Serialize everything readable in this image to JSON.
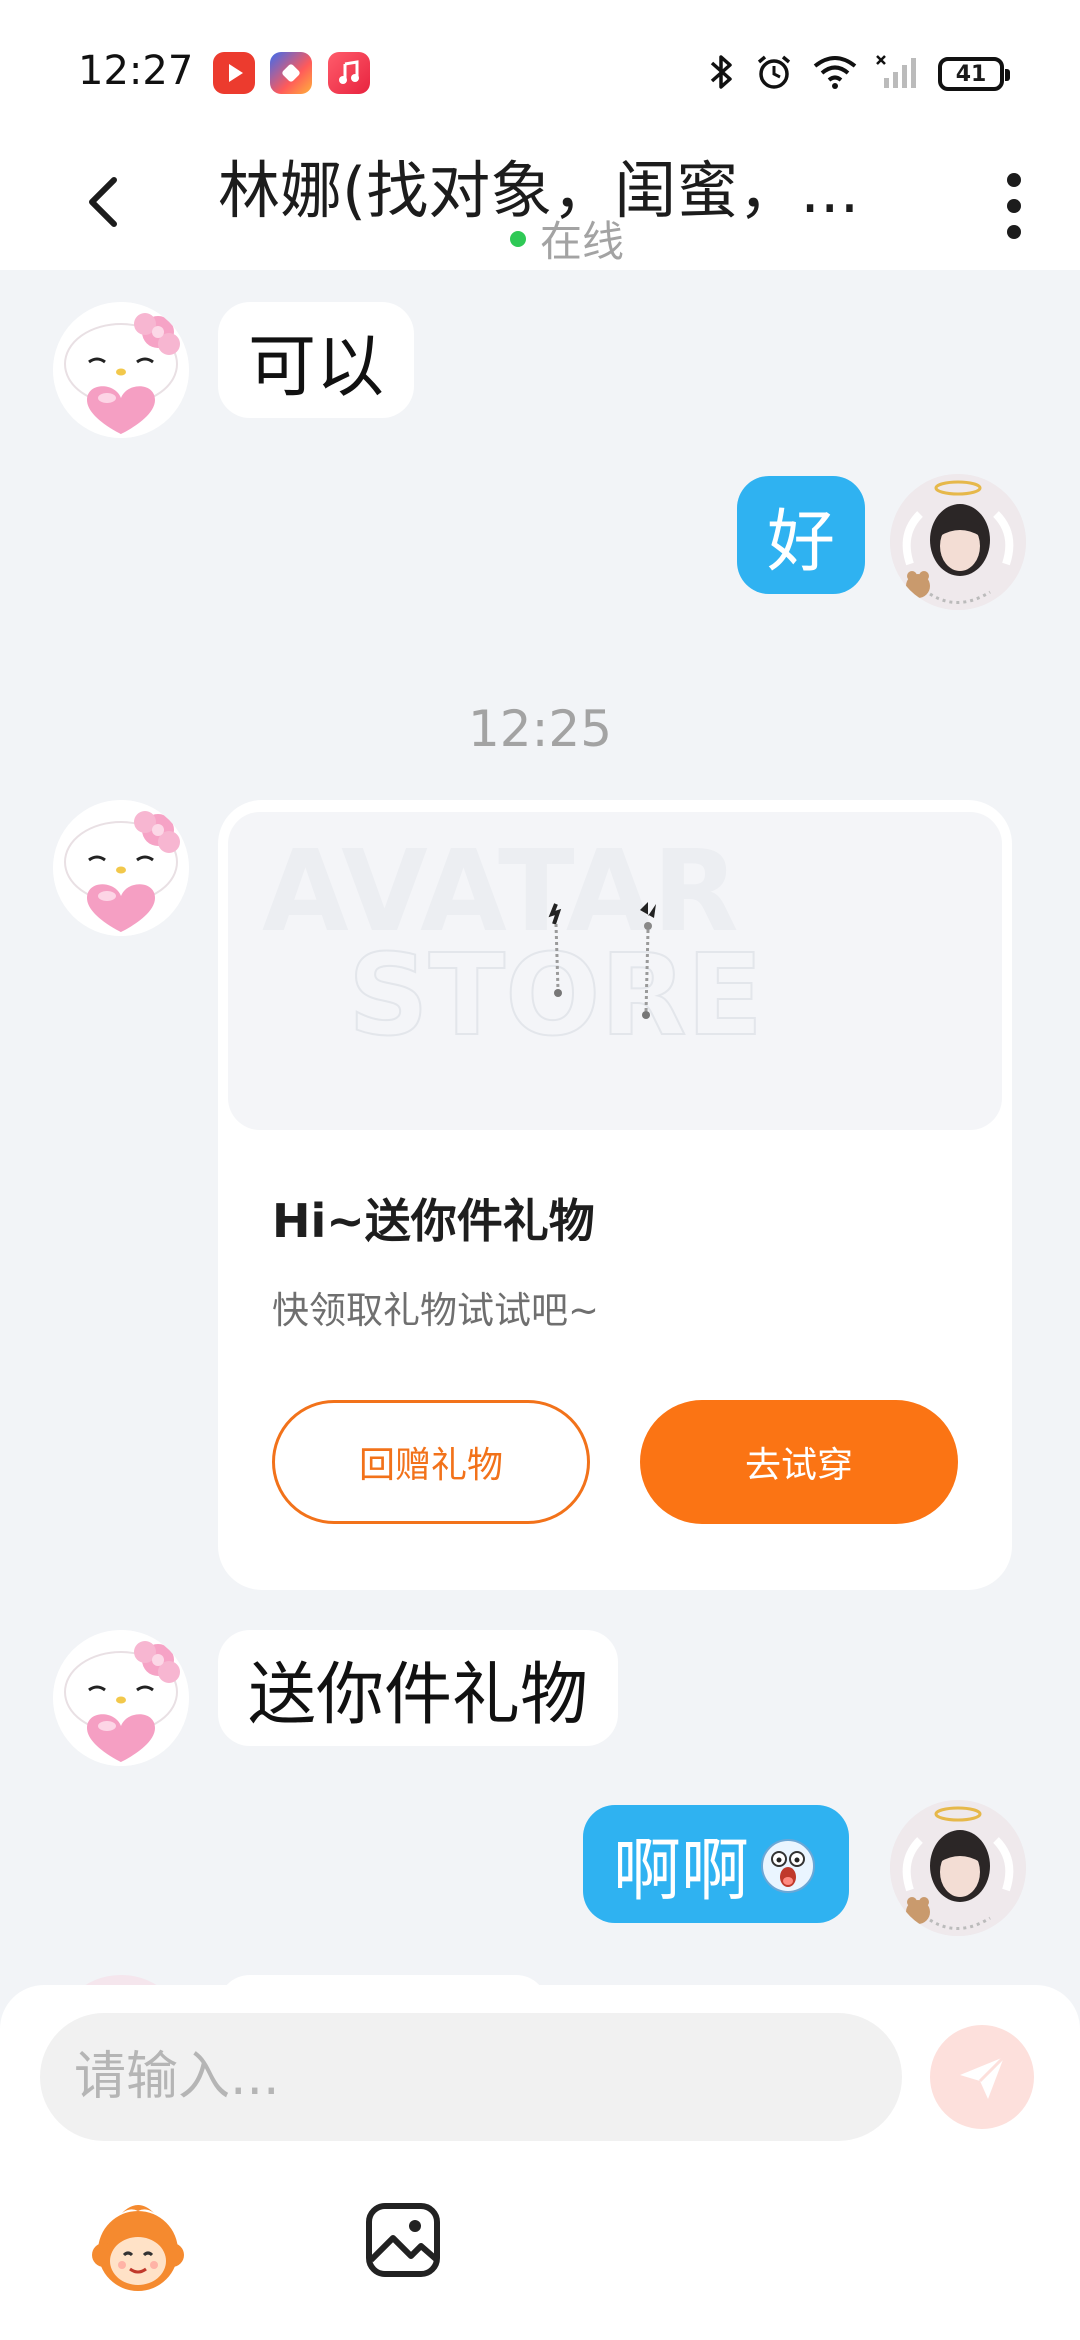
{
  "status_bar": {
    "time": "12:27",
    "app_icons": [
      "video-app-icon",
      "palette-app-icon",
      "music-app-icon"
    ],
    "battery": "41"
  },
  "header": {
    "title": "林娜(找对象，闺蜜，...",
    "status": "在线"
  },
  "messages": {
    "m1": "可以",
    "m2": "好",
    "timestamp": "12:25",
    "m3": "送你件礼物",
    "m4": "啊啊"
  },
  "gift_card": {
    "title": "Hi~送你件礼物",
    "subtitle": "快领取礼物试试吧~",
    "return_label": "回赠礼物",
    "tryon_label": "去试穿",
    "watermark_line1": "AVATAR",
    "watermark_line2": "STORE"
  },
  "composer": {
    "placeholder": "请输入..."
  },
  "colors": {
    "accent_orange": "#fb7414",
    "outgoing_bubble": "#2fb2f1",
    "online_green": "#2fc956"
  }
}
